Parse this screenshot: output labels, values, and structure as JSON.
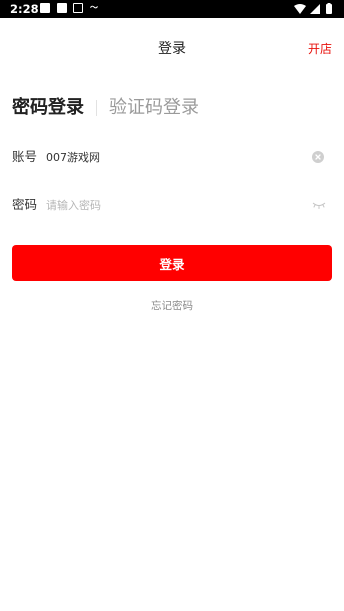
{
  "status_bar": {
    "time": "2:28",
    "icons": [
      "square-icon",
      "square-icon",
      "a-icon",
      "notification-icon",
      "wifi-icon",
      "signal-icon",
      "battery-icon"
    ],
    "small_label": "〜"
  },
  "header": {
    "title": "登录",
    "right_action": "开店"
  },
  "tabs": {
    "password_login": "密码登录",
    "code_login": "验证码登录"
  },
  "account": {
    "label": "账号",
    "value": "007游戏网"
  },
  "password": {
    "label": "密码",
    "placeholder": "请输入密码"
  },
  "login_button": "登录",
  "forgot_password": "忘记密码",
  "colors": {
    "accent": "#ff0000",
    "link_red": "#e8120c"
  }
}
